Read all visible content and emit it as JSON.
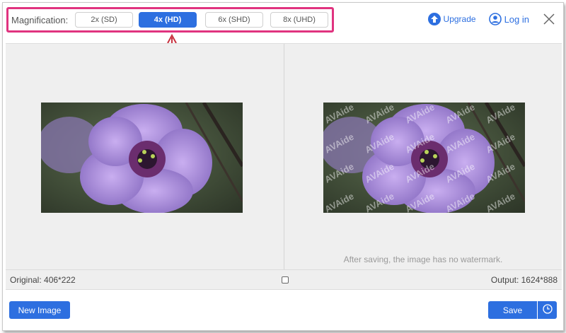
{
  "toolbar": {
    "magnification_label": "Magnification:",
    "options": [
      {
        "label": "2x (SD)",
        "selected": false
      },
      {
        "label": "4x (HD)",
        "selected": true
      },
      {
        "label": "6x (SHD)",
        "selected": false
      },
      {
        "label": "8x (UHD)",
        "selected": false
      }
    ],
    "upgrade_label": "Upgrade",
    "login_label": "Log in"
  },
  "preview": {
    "watermark_text": "AVAide",
    "no_watermark_note": "After saving, the image has no watermark."
  },
  "status": {
    "original": "Original: 406*222",
    "output": "Output: 1624*888"
  },
  "actions": {
    "new_image_label": "New Image",
    "save_label": "Save"
  },
  "colors": {
    "accent": "#2d6fe0",
    "highlight_box": "#e0337f",
    "annotation_arrow": "#c8323f"
  }
}
